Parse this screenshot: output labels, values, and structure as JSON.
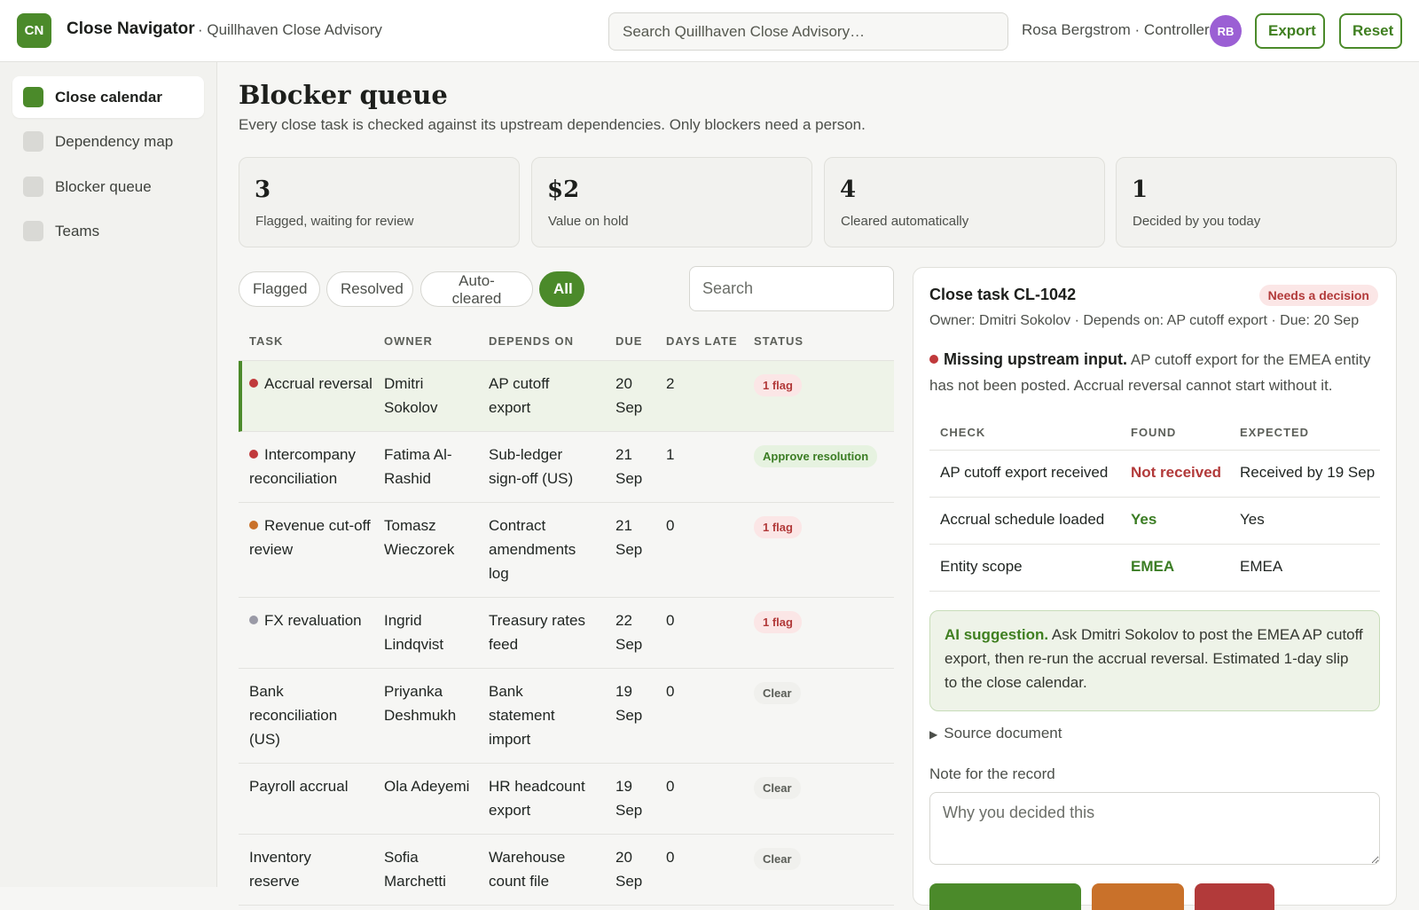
{
  "app": {
    "logo": "CN",
    "title": "Close Navigator",
    "org": "· Quillhaven Close Advisory",
    "search_placeholder": "Search Quillhaven Close Advisory…",
    "user": "Rosa Bergstrom · Controller",
    "avatar": "RB",
    "export_label": "Export",
    "reset_label": "Reset"
  },
  "sidebar": {
    "items": [
      {
        "label": "Close calendar",
        "active": true
      },
      {
        "label": "Dependency map",
        "active": false
      },
      {
        "label": "Blocker queue",
        "active": false
      },
      {
        "label": "Teams",
        "active": false
      }
    ]
  },
  "page": {
    "title": "Blocker queue",
    "subtitle": "Every close task is checked against its upstream dependencies. Only blockers need a person."
  },
  "stats": [
    {
      "value": "3",
      "label": "Flagged, waiting for review"
    },
    {
      "value": "$2",
      "label": "Value on hold"
    },
    {
      "value": "4",
      "label": "Cleared automatically"
    },
    {
      "value": "1",
      "label": "Decided by you today"
    }
  ],
  "filters": {
    "pills": [
      "Flagged",
      "Resolved",
      "Auto-cleared",
      "All"
    ],
    "active": "All",
    "search_placeholder": "Search"
  },
  "table": {
    "headers": [
      "TASK",
      "OWNER",
      "DEPENDS ON",
      "DUE",
      "DAYS LATE",
      "STATUS"
    ],
    "rows": [
      {
        "task": "Accrual reversal",
        "owner": "Dmitri Sokolov",
        "depends": "AP cutoff export",
        "due": "20 Sep",
        "late": "2",
        "status": "1 flag",
        "status_kind": "flag",
        "dot": "#c0393b",
        "selected": true
      },
      {
        "task": "Intercompany reconciliation",
        "owner": "Fatima Al-Rashid",
        "depends": "Sub-ledger sign-off (US)",
        "due": "21 Sep",
        "late": "1",
        "status": "Approve resolution",
        "status_kind": "approve",
        "dot": "#c0393b"
      },
      {
        "task": "Revenue cut-off review",
        "owner": "Tomasz Wieczorek",
        "depends": "Contract amendments log",
        "due": "21 Sep",
        "late": "0",
        "status": "1 flag",
        "status_kind": "flag",
        "dot": "#c9712a"
      },
      {
        "task": "FX revaluation",
        "owner": "Ingrid Lindqvist",
        "depends": "Treasury rates feed",
        "due": "22 Sep",
        "late": "0",
        "status": "1 flag",
        "status_kind": "flag",
        "dot": "#9a9aa6"
      },
      {
        "task": "Bank reconciliation (US)",
        "owner": "Priyanka Deshmukh",
        "depends": "Bank statement import",
        "due": "19 Sep",
        "late": "0",
        "status": "Clear",
        "status_kind": "clear",
        "dot": ""
      },
      {
        "task": "Payroll accrual",
        "owner": "Ola Adeyemi",
        "depends": "HR headcount export",
        "due": "19 Sep",
        "late": "0",
        "status": "Clear",
        "status_kind": "clear",
        "dot": ""
      },
      {
        "task": "Inventory reserve",
        "owner": "Sofia Marchetti",
        "depends": "Warehouse count file",
        "due": "20 Sep",
        "late": "0",
        "status": "Clear",
        "status_kind": "clear",
        "dot": ""
      }
    ]
  },
  "detail": {
    "title": "Close task CL-1042",
    "badge": "Needs a decision",
    "meta": "Owner: Dmitri Sokolov · Depends on: AP cutoff export · Due: 20 Sep",
    "message_title": "Missing upstream input.",
    "message_body": " AP cutoff export for the EMEA entity has not been posted. Accrual reversal cannot start without it.",
    "check_headers": [
      "CHECK",
      "FOUND",
      "EXPECTED"
    ],
    "checks": [
      {
        "check": "AP cutoff export received",
        "found": "Not received",
        "expected": "Received by 19 Sep",
        "found_color": "#b23a3a"
      },
      {
        "check": "Accrual schedule loaded",
        "found": "Yes",
        "expected": "Yes",
        "found_color": "#3b7d24"
      },
      {
        "check": "Entity scope",
        "found": "EMEA",
        "expected": "EMEA",
        "found_color": "#3b7d24"
      }
    ],
    "ai_title": "AI suggestion.",
    "ai_body": " Ask Dmitri Sokolov to post the EMEA AP cutoff export, then re-run the accrual reversal. Estimated 1-day slip to the close calendar.",
    "source_doc": "Source document",
    "note_label": "Note for the record",
    "note_placeholder": "Why you decided this"
  },
  "colors": {
    "accent": "#4b8a2a",
    "danger": "#b23a3a",
    "warning": "#c9712a",
    "avatar": "#9b5fd4"
  }
}
